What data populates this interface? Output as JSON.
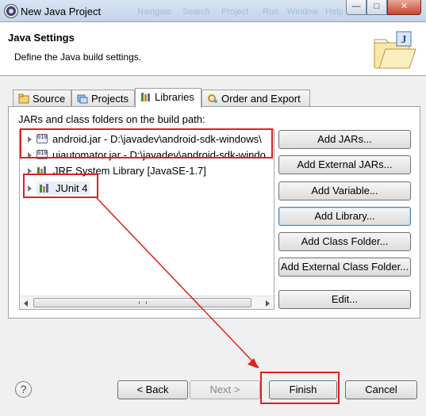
{
  "window": {
    "title": "New Java Project",
    "background_titles": [
      "Navigate",
      "Search",
      "Project",
      "Run",
      "Window",
      "Help"
    ],
    "controls": {
      "minimize": "—",
      "maximize": "□",
      "close": "✕"
    }
  },
  "header": {
    "title": "Java Settings",
    "description": "Define the Java build settings."
  },
  "tabs": [
    {
      "label": "Source",
      "icon": "source-folder-icon"
    },
    {
      "label": "Projects",
      "icon": "projects-icon"
    },
    {
      "label": "Libraries",
      "icon": "libraries-icon",
      "active": true
    },
    {
      "label": "Order and Export",
      "icon": "order-export-icon"
    }
  ],
  "libraries": {
    "heading": "JARs and class folders on the build path:",
    "items": [
      {
        "label": "android.jar - D:\\javadev\\android-sdk-windows\\",
        "icon": "jar-icon"
      },
      {
        "label": "uiautomator.jar - D:\\javadev\\android-sdk-windo",
        "icon": "jar-icon"
      },
      {
        "label": "JRE System Library [JavaSE-1.7]",
        "icon": "library-icon"
      },
      {
        "label": "JUnit 4",
        "icon": "library-icon"
      }
    ],
    "buttons": {
      "add_jars": "Add JARs...",
      "add_external_jars": "Add External JARs...",
      "add_variable": "Add Variable...",
      "add_library": "Add Library...",
      "add_class_folder": "Add Class Folder...",
      "add_external_class_folder": "Add External Class Folder...",
      "edit": "Edit..."
    }
  },
  "footer": {
    "help": "?",
    "back": "< Back",
    "next": "Next >",
    "finish": "Finish",
    "cancel": "Cancel"
  },
  "colors": {
    "annotation_red": "#e02020",
    "focus_blue": "#3c7fb1",
    "title_bar": "#c2d5ea"
  }
}
